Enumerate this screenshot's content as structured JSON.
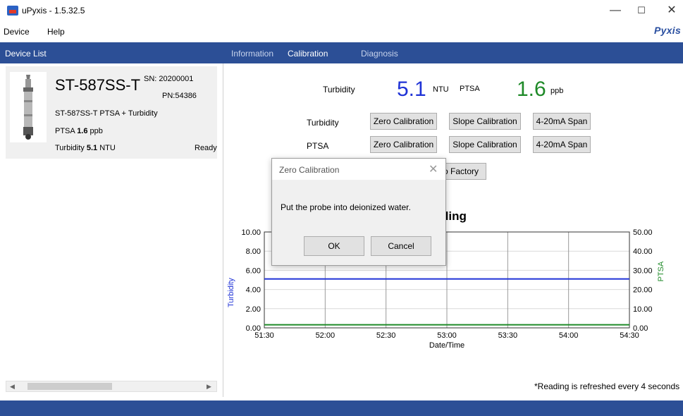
{
  "window": {
    "title": "uPyxis - 1.5.32.5",
    "minimize_glyph": "—",
    "maximize_glyph": "☐",
    "close_glyph": "✕"
  },
  "menu": {
    "device": "Device",
    "help": "Help",
    "brand": "Pyxis"
  },
  "left": {
    "header": "Device List",
    "device": {
      "name": "ST-587SS-T",
      "sn": "SN: 20200001",
      "pn": "PN:54386",
      "desc": "ST-587SS-T PTSA + Turbidity",
      "ptsa_label": "PTSA",
      "ptsa_value": "1.6",
      "ptsa_unit": "ppb",
      "turb_label": "Turbidity",
      "turb_value": "5.1",
      "turb_unit": "NTU",
      "status": "Ready"
    },
    "scroll_left": "◀",
    "scroll_right": "▶"
  },
  "tabs": {
    "information": "Information",
    "calibration": "Calibration",
    "diagnosis": "Diagnosis"
  },
  "readings": {
    "turb_label": "Turbidity",
    "turb_value": "5.1",
    "turb_unit": "NTU",
    "ptsa_label": "PTSA",
    "ptsa_value": "1.6",
    "ptsa_unit": "ppb"
  },
  "calibration": {
    "turb_label": "Turbidity",
    "ptsa_label": "PTSA",
    "zero": "Zero Calibration",
    "slope": "Slope Calibration",
    "span": "4-20mA Span",
    "factory": "o Factory"
  },
  "chart_title": "ding",
  "refresh_note": "*Reading is refreshed every 4 seconds",
  "dialog": {
    "title": "Zero Calibration",
    "close": "✕",
    "message": "Put the probe into deionized water.",
    "ok": "OK",
    "cancel": "Cancel"
  },
  "colors": {
    "accent": "#2c4f96",
    "turbidity": "#1f32d6",
    "ptsa": "#1f8a28"
  },
  "chart_data": {
    "type": "line",
    "title": "",
    "xlabel": "Date/Time",
    "ylabel": "Turbidity",
    "ylabel_right": "PTSA",
    "x_ticks": [
      "51:30",
      "52:00",
      "52:30",
      "53:00",
      "53:30",
      "54:00",
      "54:30"
    ],
    "y_ticks_left": [
      "0.00",
      "2.00",
      "4.00",
      "6.00",
      "8.00",
      "10.00"
    ],
    "y_ticks_right": [
      "0.00",
      "10.00",
      "20.00",
      "30.00",
      "40.00",
      "50.00"
    ],
    "ylim": [
      0,
      10
    ],
    "ylim_right": [
      0,
      50
    ],
    "grid": true,
    "series": [
      {
        "name": "Turbidity",
        "axis": "left",
        "color": "#1f32d6",
        "x": [
          "51:30",
          "54:30"
        ],
        "values": [
          5.1,
          5.1
        ]
      },
      {
        "name": "PTSA",
        "axis": "right",
        "color": "#1f8a28",
        "x": [
          "51:30",
          "54:30"
        ],
        "values": [
          1.6,
          1.6
        ]
      }
    ]
  }
}
